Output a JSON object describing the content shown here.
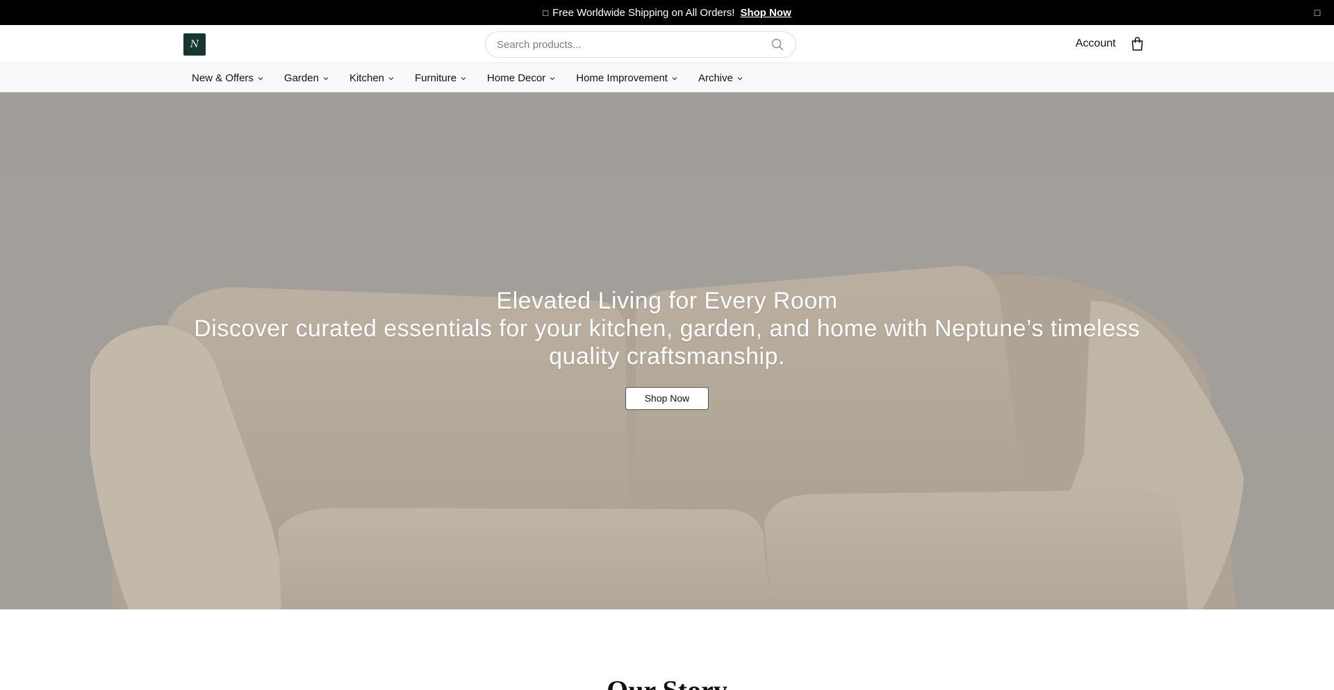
{
  "announcement": {
    "icon": "□",
    "text": "Free Worldwide Shipping on All Orders!",
    "link": "Shop Now",
    "close_icon": "□"
  },
  "header": {
    "logo_letter": "N",
    "search_placeholder": "Search products...",
    "account_label": "Account",
    "bag_icon": "shopping-bag-icon"
  },
  "nav": {
    "items": [
      {
        "label": "New & Offers"
      },
      {
        "label": "Garden"
      },
      {
        "label": "Kitchen"
      },
      {
        "label": "Furniture"
      },
      {
        "label": "Home Decor"
      },
      {
        "label": "Home Improvement"
      },
      {
        "label": "Archive"
      }
    ]
  },
  "hero": {
    "title": "Elevated Living for Every Room",
    "subtitle": "Discover curated essentials for your kitchen, garden, and home with Neptune’s timeless quality craftsmanship.",
    "button": "Shop Now",
    "overlay_color": "#a6a49f",
    "sofa_color": "#c9bca9"
  },
  "story": {
    "title": "Our Story"
  }
}
